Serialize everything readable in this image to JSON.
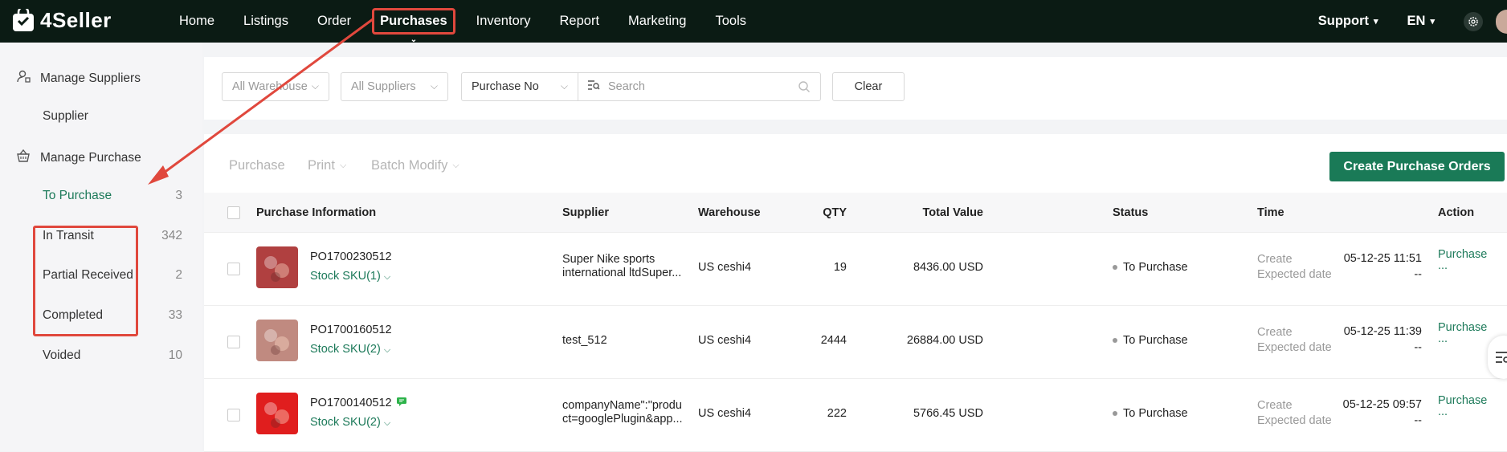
{
  "brand": {
    "name": "4Seller"
  },
  "nav": {
    "items": [
      "Home",
      "Listings",
      "Order",
      "Purchases",
      "Inventory",
      "Report",
      "Marketing",
      "Tools"
    ]
  },
  "top_right": {
    "support": "Support",
    "language": "EN"
  },
  "sidebar": {
    "group1": "Manage Suppliers",
    "supplier": "Supplier",
    "group2": "Manage Purchase",
    "items": [
      {
        "label": "To Purchase",
        "count": "3"
      },
      {
        "label": "In Transit",
        "count": "342"
      },
      {
        "label": "Partial Received",
        "count": "2"
      },
      {
        "label": "Completed",
        "count": "33"
      },
      {
        "label": "Voided",
        "count": "10"
      }
    ]
  },
  "filters": {
    "warehouse": "All Warehouse",
    "suppliers": "All Suppliers",
    "search_type": "Purchase No",
    "search_placeholder": "Search",
    "clear": "Clear"
  },
  "toolbar": {
    "purchase": "Purchase",
    "print": "Print",
    "batch_modify": "Batch Modify",
    "create": "Create Purchase Orders"
  },
  "table": {
    "headers": {
      "info": "Purchase Information",
      "supplier": "Supplier",
      "warehouse": "Warehouse",
      "qty": "QTY",
      "total": "Total Value",
      "status": "Status",
      "time": "Time",
      "action": "Action"
    },
    "rows": [
      {
        "po": "PO1700230512",
        "sku": "Stock SKU(1)",
        "supplier1": "Super Nike sports",
        "supplier2": "international ltdSuper...",
        "warehouse": "US ceshi4",
        "qty": "19",
        "total": "8436.00 USD",
        "status": "To Purchase",
        "create_label": "Create",
        "create_time": "05-12-25 11:51",
        "expected_label": "Expected date",
        "expected_time": "--",
        "action": "Purchase",
        "more": "...",
        "thumb": "#b04040",
        "has_note": false
      },
      {
        "po": "PO1700160512",
        "sku": "Stock SKU(2)",
        "supplier1": "test_512",
        "supplier2": "",
        "warehouse": "US ceshi4",
        "qty": "2444",
        "total": "26884.00 USD",
        "status": "To Purchase",
        "create_label": "Create",
        "create_time": "05-12-25 11:39",
        "expected_label": "Expected date",
        "expected_time": "--",
        "action": "Purchase",
        "more": "...",
        "thumb": "#c08a80",
        "has_note": false
      },
      {
        "po": "PO1700140512",
        "sku": "Stock SKU(2)",
        "supplier1": "companyName\":\"produ",
        "supplier2": "ct=googlePlugin&app...",
        "warehouse": "US ceshi4",
        "qty": "222",
        "total": "5766.45 USD",
        "status": "To Purchase",
        "create_label": "Create",
        "create_time": "05-12-25 09:57",
        "expected_label": "Expected date",
        "expected_time": "--",
        "action": "Purchase",
        "more": "...",
        "thumb": "#e01e1e",
        "has_note": true
      }
    ]
  },
  "colors": {
    "accent": "#1a7a57",
    "highlight": "#e0483d",
    "topbar": "#0b1b14"
  }
}
